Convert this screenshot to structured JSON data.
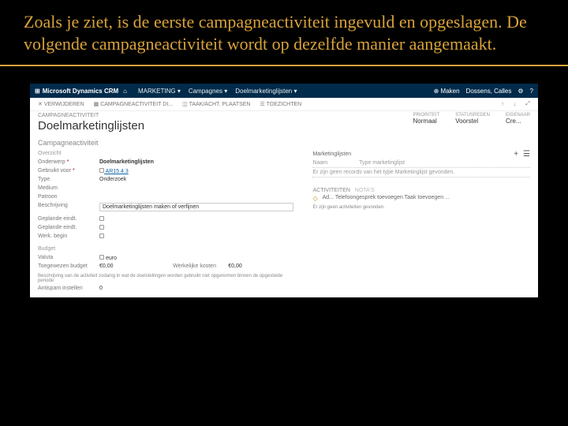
{
  "slide": {
    "text": "Zoals je ziet, is de eerste campagneactiviteit ingevuld en opgeslagen. De volgende campagneactiviteit wordt op dezelfde manier aangemaakt."
  },
  "topbar": {
    "brand": "Microsoft Dynamics CRM",
    "nav": [
      "MARKETING",
      "Campagnes",
      "Doelmarketinglijsten"
    ],
    "create": "Maken",
    "user": "Dossens, Calles"
  },
  "cmdbar": [
    "VERWIJDEREN",
    "CAMPAGNEACTIVITEIT DI...",
    "TAAK/ACHT. PLAATSEN",
    "TOEZICHTEN"
  ],
  "header": {
    "breadcrumb": "CAMPAGNEACTIVITEIT",
    "title": "Doelmarketinglijsten",
    "fields": [
      {
        "k": "PRIORITEIT",
        "v": "Normaal"
      },
      {
        "k": "STATUSREDEN",
        "v": "Voorstel"
      },
      {
        "k": "EIGENAAR",
        "v": "Cre..."
      }
    ]
  },
  "section": {
    "title": "Campagneactiviteit",
    "overview_label": "Overzicht",
    "rows": {
      "onderwerp_lbl": "Onderwerp",
      "onderwerp_val": "Doelmarketinglijsten",
      "gebruikt_lbl": "Gebruikt voor",
      "gebruikt_val": "AR15.4.3",
      "type_lbl": "Type",
      "type_val": "Onderzoek",
      "medium_lbl": "Medium",
      "patroon_lbl": "Patroon",
      "beschrijving_lbl": "Beschrijving",
      "beschrijving_val": "Doelmarketinglijsten maken of verfijnen"
    },
    "dates_label": "",
    "dates": {
      "begindatum_lbl": "Geplande eindt.",
      "einddatum_lbl": "Geplande eindt.",
      "werkbegin_lbl": "Werk. begin"
    },
    "budget_label": "Budget",
    "budget": {
      "valuta_lbl": "Valuta",
      "valuta_val": "euro",
      "toegewezen_lbl": "Toegewezen budget",
      "toegewezen_val": "€0,00",
      "werkelijke_lbl": "Werkelijke kosten",
      "werkelijke_val": "€0,00"
    },
    "note": "Beschrijving van de activiteit zodanig in wat de doelstellingen worden gebruikt niet opgenomen binnen de opgestelde periode",
    "anti_lbl": "Antispam instellen",
    "anti_val": "0"
  },
  "mlist": {
    "title": "Marketinglijsten",
    "col1": "Naam",
    "col2": "Type marketinglijst",
    "empty": "Er zijn geen records van het type Marketinglijst gevonden."
  },
  "related": {
    "title": "ACTIVITEITEN",
    "sub": "NOTA'S",
    "items": [
      "Ad...  Telefoongesprek toevoegen  Taak toevoegen  ..."
    ],
    "none": "Er zijn geen activiteiten gevonden."
  }
}
